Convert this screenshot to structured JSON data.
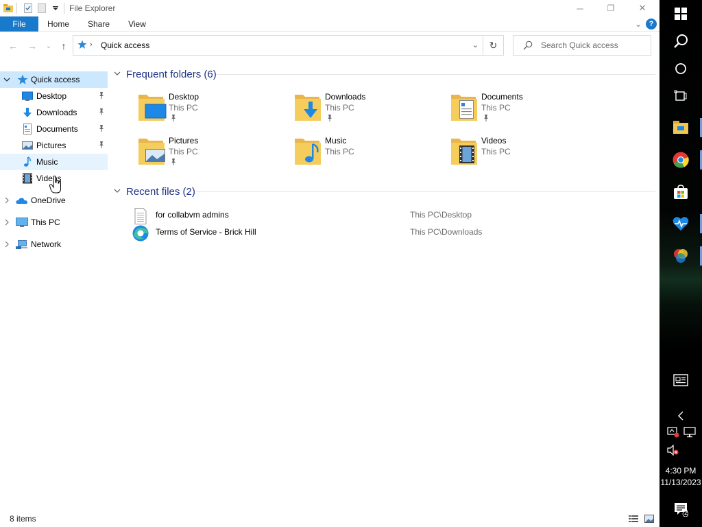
{
  "window": {
    "title": "File Explorer",
    "caption_buttons": {
      "minimize": "─",
      "restore": "❐",
      "close": "✕"
    }
  },
  "ribbon": {
    "tabs": [
      "File",
      "Home",
      "Share",
      "View"
    ],
    "expand_glyph": "⌄",
    "help_label": "?"
  },
  "address": {
    "path": "Quick access",
    "separator": "›",
    "dropdown_glyph": "⌄",
    "refresh_glyph": "↻",
    "back_glyph": "←",
    "forward_glyph": "→",
    "recent_glyph": "⌄",
    "up_glyph": "↑"
  },
  "search": {
    "placeholder": "Search Quick access"
  },
  "nav": {
    "items": [
      {
        "label": "Quick access",
        "icon": "star-icon",
        "expanded": true,
        "selected": true
      },
      {
        "label": "Desktop",
        "icon": "desktop-icon",
        "pinned": true
      },
      {
        "label": "Downloads",
        "icon": "download-icon",
        "pinned": true
      },
      {
        "label": "Documents",
        "icon": "documents-icon",
        "pinned": true
      },
      {
        "label": "Pictures",
        "icon": "pictures-icon",
        "pinned": true
      },
      {
        "label": "Music",
        "icon": "music-icon",
        "hovered": true
      },
      {
        "label": "Videos",
        "icon": "videos-icon"
      },
      {
        "label": "OneDrive",
        "icon": "onedrive-icon",
        "expandable": true
      },
      {
        "label": "This PC",
        "icon": "this-pc-icon",
        "expandable": true
      },
      {
        "label": "Network",
        "icon": "network-icon",
        "expandable": true
      }
    ]
  },
  "frequent": {
    "header": "Frequent folders (6)",
    "folders": [
      {
        "name": "Desktop",
        "location": "This PC",
        "pinned": true,
        "icon": "desktop-folder-icon"
      },
      {
        "name": "Downloads",
        "location": "This PC",
        "pinned": true,
        "icon": "downloads-folder-icon"
      },
      {
        "name": "Documents",
        "location": "This PC",
        "pinned": true,
        "icon": "documents-folder-icon"
      },
      {
        "name": "Pictures",
        "location": "This PC",
        "pinned": true,
        "icon": "pictures-folder-icon"
      },
      {
        "name": "Music",
        "location": "This PC",
        "pinned": false,
        "icon": "music-folder-icon"
      },
      {
        "name": "Videos",
        "location": "This PC",
        "pinned": false,
        "icon": "videos-folder-icon"
      }
    ]
  },
  "recent": {
    "header": "Recent files (2)",
    "files": [
      {
        "name": "for collabvm admins",
        "location": "This PC\\Desktop",
        "icon": "text-file-icon"
      },
      {
        "name": "Terms of Service - Brick Hill",
        "location": "This PC\\Downloads",
        "icon": "edge-icon"
      }
    ]
  },
  "status": {
    "item_count": "8 items"
  },
  "taskbar": {
    "time": "4:30 PM",
    "date": "11/13/2023",
    "notification_count": "2",
    "items": [
      "windows-start-icon",
      "search-icon",
      "cortana-icon",
      "task-view-icon",
      "file-explorer-icon",
      "chrome-icon",
      "microsoft-store-icon",
      "health-app-icon",
      "color-app-icon"
    ],
    "tray": [
      "news-icon",
      "chevron-left-icon",
      "network-icon",
      "display-icon",
      "volume-muted-icon"
    ]
  },
  "colors": {
    "accent": "#1979ca",
    "selection": "#cce8ff",
    "hover": "#e5f3ff",
    "header_text": "#1e3287",
    "folder": "#f2c652"
  }
}
